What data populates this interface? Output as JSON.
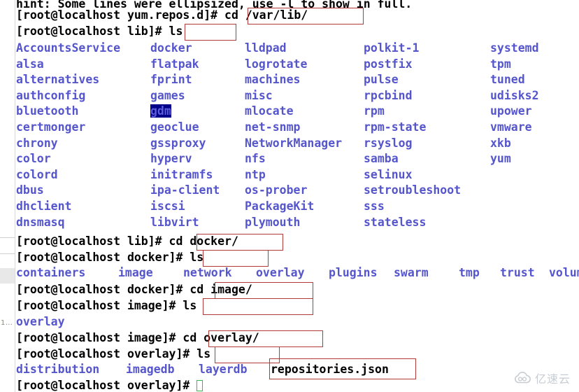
{
  "terminal": {
    "hint_line": "hint: Some lines were ellipsized, use -l to show in full.",
    "cursor_glyph": "",
    "colors": {
      "background": "#ffffff",
      "text": "#000000",
      "directory": "#5555cc",
      "highlight_background": "#00008b",
      "highlight_text": "#5e5ed8",
      "annotation_box": "#b03a3a",
      "cursor": "#2bbf4a"
    }
  },
  "gutter": {
    "page_label": "1…"
  },
  "session": [
    {
      "prompt": "[root@localhost yum.repos.d]# ",
      "command": "cd /var/lib/"
    },
    {
      "prompt": "[root@localhost lib]# ",
      "command": "ls"
    }
  ],
  "lib_listing": {
    "columns": [
      [
        "AccountsService",
        "alsa",
        "alternatives",
        "authconfig",
        "bluetooth",
        "certmonger",
        "chrony",
        "color",
        "colord",
        "dbus",
        "dhclient",
        "dnsmasq"
      ],
      [
        "docker",
        "flatpak",
        "fprint",
        "games",
        "gdm",
        "geoclue",
        "gssproxy",
        "hyperv",
        "initramfs",
        "ipa-client",
        "iscsi",
        "libvirt"
      ],
      [
        "lldpad",
        "logrotate",
        "machines",
        "misc",
        "mlocate",
        "net-snmp",
        "NetworkManager",
        "nfs",
        "ntp",
        "os-prober",
        "PackageKit",
        "plymouth"
      ],
      [
        "polkit-1",
        "postfix",
        "pulse",
        "rpcbind",
        "rpm",
        "rpm-state",
        "rsyslog",
        "samba",
        "selinux",
        "setroubleshoot",
        "sss",
        "stateless"
      ],
      [
        "systemd",
        "tpm",
        "tuned",
        "udisks2",
        "upower",
        "vmware",
        "xkb",
        "yum"
      ]
    ],
    "highlighted_entry": "gdm"
  },
  "docker_section": {
    "cd_prompt": "[root@localhost lib]# ",
    "cd_command": "cd docker/",
    "ls_prompt": "[root@localhost docker]# ",
    "ls_command": "ls",
    "entries": [
      "containers",
      "image",
      "network",
      "overlay",
      "plugins",
      "swarm",
      "tmp",
      "trust",
      "volumes"
    ]
  },
  "image_section": {
    "cd_prompt": "[root@localhost docker]# ",
    "cd_command": "cd image/",
    "ls_prompt": "[root@localhost image]# ",
    "ls_command": "ls",
    "entries": [
      "overlay"
    ]
  },
  "overlay_section": {
    "cd_prompt": "[root@localhost image]# ",
    "cd_command": "cd overlay/",
    "ls_prompt": "[root@localhost overlay]# ",
    "ls_command": "ls",
    "dir_entries": [
      "distribution",
      "imagedb",
      "layerdb"
    ],
    "file_entries": [
      "repositories.json"
    ],
    "final_prompt": "[root@localhost overlay]# "
  },
  "watermark": {
    "text": "亿速云",
    "icon": "cloud-icon"
  }
}
